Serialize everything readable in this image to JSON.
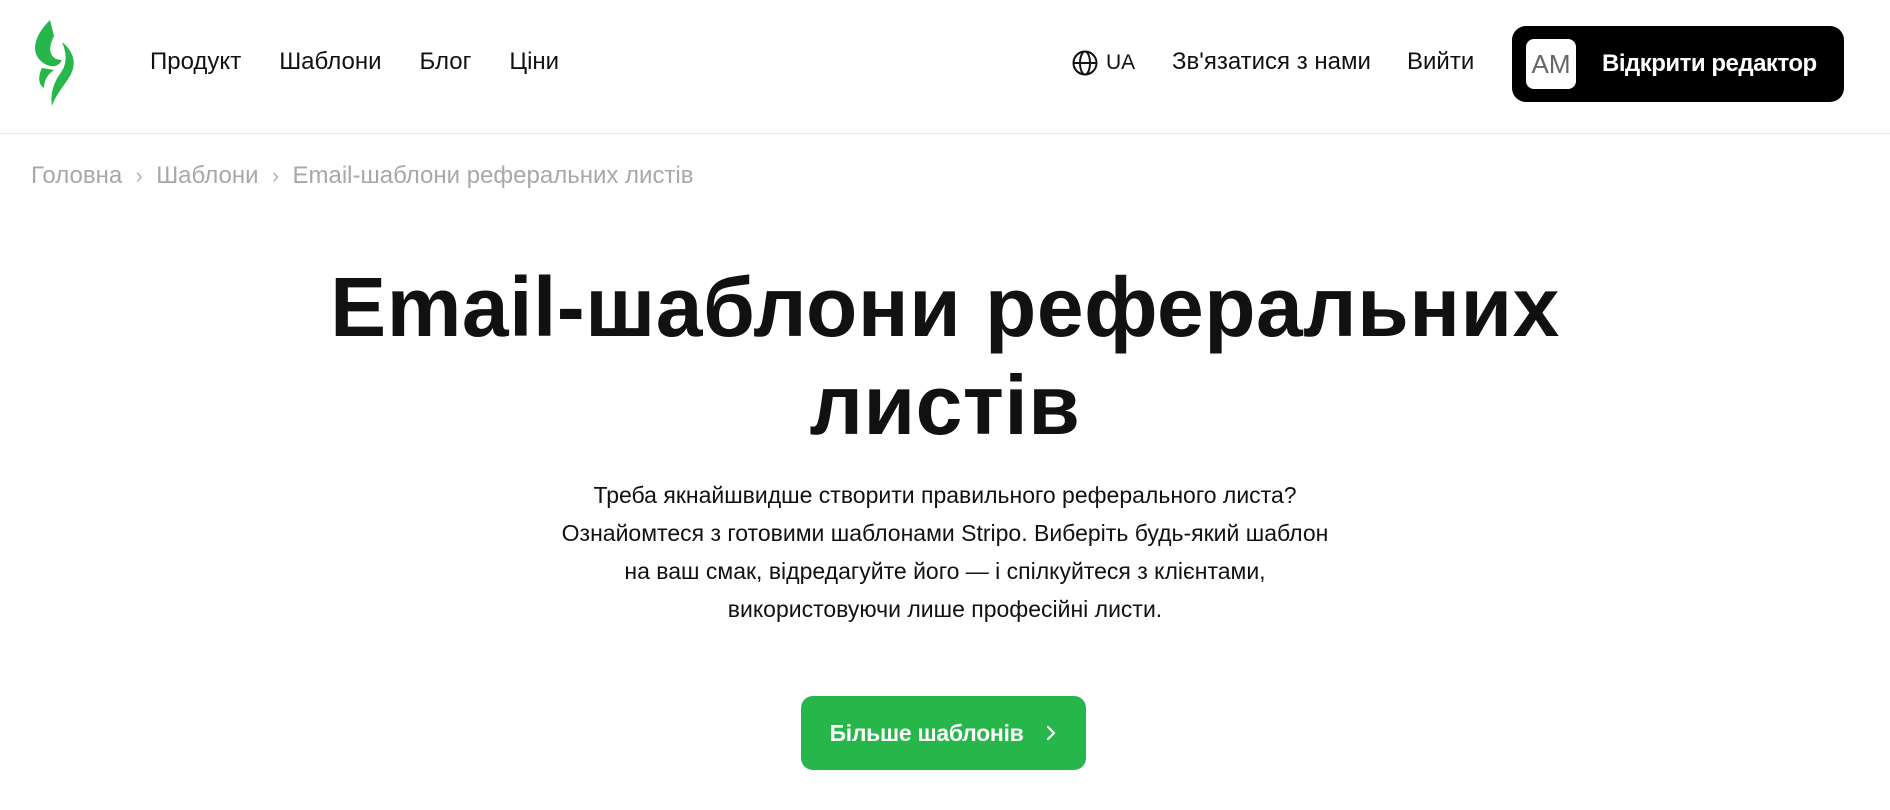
{
  "header": {
    "logo_icon": "stripo-logo-icon",
    "nav": [
      {
        "label": "Продукт"
      },
      {
        "label": "Шаблони"
      },
      {
        "label": "Блог"
      },
      {
        "label": "Ціни"
      }
    ],
    "language": {
      "icon": "globe-icon",
      "label": "UA"
    },
    "contact_label": "Зв'язатися з нами",
    "logout_label": "Вийти",
    "editor_button": {
      "avatar_initials": "AM",
      "label": "Відкрити редактор"
    }
  },
  "breadcrumb": [
    {
      "label": "Головна"
    },
    {
      "label": "Шаблони"
    },
    {
      "label": "Email-шаблони реферальних листів"
    }
  ],
  "main": {
    "title_lines": [
      "Email-шаблони реферальних",
      "листів"
    ],
    "description_lines": [
      "Треба якнайшвидше створити правильного реферального листа?",
      "Ознайомтеся з готовими шаблонами Stripo. Виберіть будь-який шаблон",
      "на ваш смак, відредагуйте його — і спілкуйтеся з клієнтами,",
      "використовуючи лише професійні листи."
    ],
    "more_button": {
      "label": "Більше шаблонів",
      "icon": "chevron-right-icon"
    }
  },
  "colors": {
    "brand_green": "#27b64a",
    "editor_button_bg": "#000000",
    "breadcrumb_text": "#a8a8a8"
  }
}
